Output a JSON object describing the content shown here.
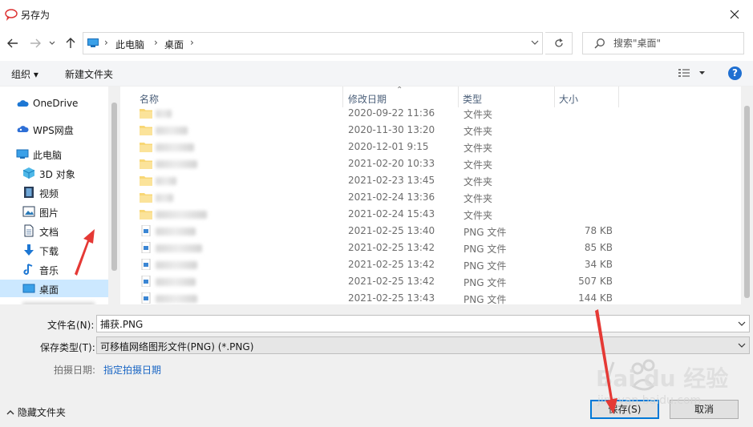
{
  "window": {
    "title": "另存为"
  },
  "nav": {
    "breadcrumbs": [
      "此电脑",
      "桌面"
    ],
    "search_placeholder": "搜索\"桌面\""
  },
  "toolbar": {
    "organize": "组织",
    "new_folder": "新建文件夹"
  },
  "sidebar": {
    "items": [
      {
        "label": "OneDrive",
        "icon": "cloud-icon"
      },
      {
        "label": "WPS网盘",
        "icon": "wps-cloud-icon"
      },
      {
        "label": "此电脑",
        "icon": "computer-icon"
      },
      {
        "label": "3D 对象",
        "icon": "cube-icon"
      },
      {
        "label": "视频",
        "icon": "video-icon"
      },
      {
        "label": "图片",
        "icon": "picture-icon"
      },
      {
        "label": "文档",
        "icon": "document-icon"
      },
      {
        "label": "下载",
        "icon": "download-icon"
      },
      {
        "label": "音乐",
        "icon": "music-icon"
      },
      {
        "label": "桌面",
        "icon": "desktop-icon",
        "selected": true
      }
    ]
  },
  "filelist": {
    "columns": [
      "名称",
      "修改日期",
      "类型",
      "大小"
    ],
    "rows": [
      {
        "date": "2020-09-22 11:36",
        "type": "文件夹",
        "size": "",
        "kind": "folder"
      },
      {
        "date": "2020-11-30 13:20",
        "type": "文件夹",
        "size": "",
        "kind": "folder"
      },
      {
        "date": "2020-12-01 9:15",
        "type": "文件夹",
        "size": "",
        "kind": "folder"
      },
      {
        "date": "2021-02-20 10:33",
        "type": "文件夹",
        "size": "",
        "kind": "folder"
      },
      {
        "date": "2021-02-23 13:45",
        "type": "文件夹",
        "size": "",
        "kind": "folder"
      },
      {
        "date": "2021-02-24 13:36",
        "type": "文件夹",
        "size": "",
        "kind": "folder"
      },
      {
        "date": "2021-02-24 15:43",
        "type": "文件夹",
        "size": "",
        "kind": "folder"
      },
      {
        "date": "2021-02-25 13:40",
        "type": "PNG 文件",
        "size": "78 KB",
        "kind": "png"
      },
      {
        "date": "2021-02-25 13:42",
        "type": "PNG 文件",
        "size": "85 KB",
        "kind": "png"
      },
      {
        "date": "2021-02-25 13:42",
        "type": "PNG 文件",
        "size": "34 KB",
        "kind": "png"
      },
      {
        "date": "2021-02-25 13:42",
        "type": "PNG 文件",
        "size": "507 KB",
        "kind": "png"
      },
      {
        "date": "2021-02-25 13:43",
        "type": "PNG 文件",
        "size": "144 KB",
        "kind": "png"
      }
    ]
  },
  "form": {
    "filename_label": "文件名(N):",
    "filename_value": "捕获.PNG",
    "filetype_label": "保存类型(T):",
    "filetype_value": "可移植网络图形文件(PNG) (*.PNG)",
    "date_label": "拍摄日期:",
    "date_link": "指定拍摄日期",
    "hide_folders": "隐藏文件夹",
    "save": "保存(S)",
    "cancel": "取消"
  },
  "colors": {
    "accent": "#0078d7",
    "selection": "#cce8ff",
    "arrow": "#e53935"
  }
}
